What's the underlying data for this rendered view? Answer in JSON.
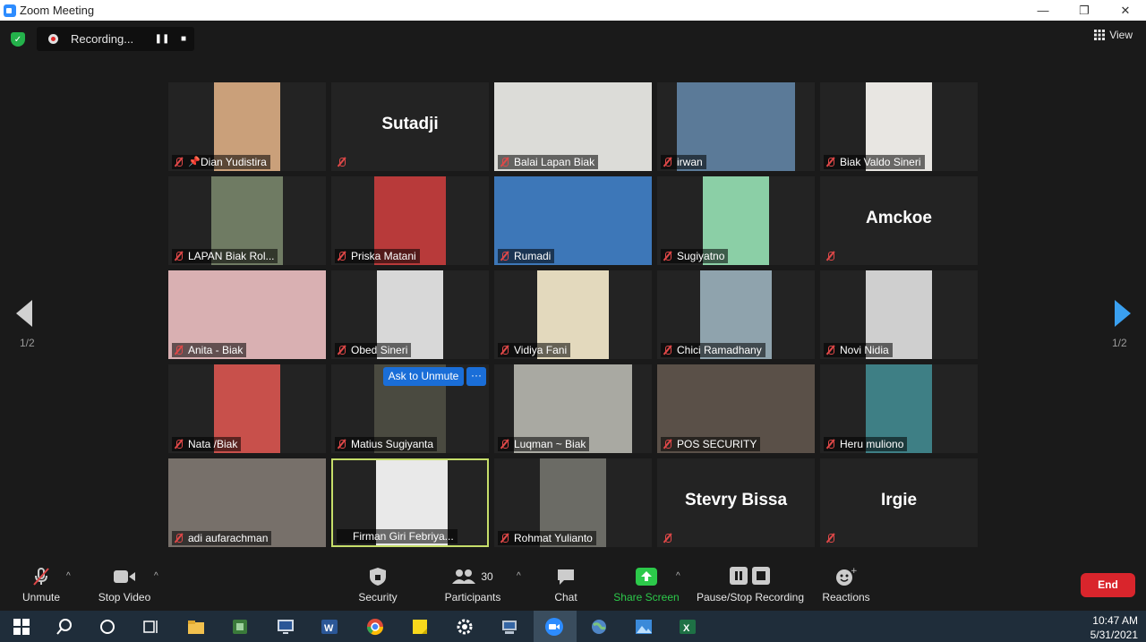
{
  "window": {
    "title": "Zoom Meeting",
    "minimize": "—",
    "maximize": "❐",
    "close": "✕"
  },
  "recording": {
    "status": "Recording...",
    "pause": "❚❚",
    "stop": "■"
  },
  "view_label": "View",
  "pagination": {
    "left": "1/2",
    "right": "1/2"
  },
  "ask_to_unmute": {
    "label": "Ask to Unmute",
    "more": "···"
  },
  "tiles": [
    {
      "name": "Dian Yudistira",
      "pinned": true,
      "video": true,
      "bg": "#caa07a",
      "vx": 51,
      "vw": 74
    },
    {
      "name": "Sutadji",
      "video": false,
      "label": false
    },
    {
      "name": "Balai Lapan Biak",
      "video": true,
      "bg": "#dcdcd8",
      "vx": 0,
      "vw": 176
    },
    {
      "name": "irwan",
      "video": true,
      "bg": "#5b7a98",
      "vx": 22,
      "vw": 132
    },
    {
      "name": "Biak Valdo Sineri",
      "video": true,
      "bg": "#e8e6e2",
      "vx": 51,
      "vw": 74
    },
    {
      "name": "LAPAN Biak Rol...",
      "video": true,
      "bg": "#6f7b63",
      "vx": 48,
      "vw": 80
    },
    {
      "name": "Priska Matani",
      "video": true,
      "bg": "#b83a3a",
      "vx": 48,
      "vw": 80
    },
    {
      "name": "Rumadi",
      "video": true,
      "bg": "#3d77b8",
      "vx": 0,
      "vw": 176
    },
    {
      "name": "Sugiyatno",
      "video": true,
      "bg": "#8bcfa6",
      "vx": 51,
      "vw": 74
    },
    {
      "name": "Amckoe",
      "video": false,
      "label": false
    },
    {
      "name": "Anita - Biak",
      "video": true,
      "bg": "#d9b0b2",
      "vx": 0,
      "vw": 176
    },
    {
      "name": "Obed Sineri",
      "video": true,
      "bg": "#d8d8d8",
      "vx": 51,
      "vw": 74
    },
    {
      "name": "Vidiya Fani",
      "video": true,
      "bg": "#e3d9bd",
      "vx": 48,
      "vw": 80
    },
    {
      "name": "Chici Ramadhany",
      "video": true,
      "bg": "#8fa3ad",
      "vx": 48,
      "vw": 80
    },
    {
      "name": "Novi Nidia",
      "video": true,
      "bg": "#cfcfcf",
      "vx": 51,
      "vw": 74
    },
    {
      "name": "Nata /Biak",
      "video": true,
      "bg": "#c8504b",
      "vx": 51,
      "vw": 74
    },
    {
      "name": "Matius Sugiyanta",
      "video": true,
      "bg": "#4a4a40",
      "vx": 48,
      "vw": 80
    },
    {
      "name": "Luqman ~ Biak",
      "video": true,
      "bg": "#a9a9a2",
      "vx": 22,
      "vw": 132
    },
    {
      "name": "POS SECURITY",
      "video": true,
      "bg": "#5a5048",
      "vx": 0,
      "vw": 176
    },
    {
      "name": "Heru muliono",
      "video": true,
      "bg": "#3e7f85",
      "vx": 51,
      "vw": 74
    },
    {
      "name": "adi aufarachman",
      "video": true,
      "bg": "#77706a",
      "vx": 0,
      "vw": 176
    },
    {
      "name": "Firman Giri Febriya...",
      "video": true,
      "bg": "#e9e9e9",
      "vx": 48,
      "vw": 80,
      "active": true,
      "muteIcon": false
    },
    {
      "name": "Rohmat Yulianto",
      "video": true,
      "bg": "#6b6b65",
      "vx": 51,
      "vw": 74
    },
    {
      "name": "Stevry Bissa",
      "video": false,
      "label": false
    },
    {
      "name": "Irgie",
      "video": false,
      "label": false
    }
  ],
  "toolbar": {
    "unmute": "Unmute",
    "stop_video": "Stop Video",
    "security": "Security",
    "participants": "Participants",
    "participants_count": "30",
    "chat": "Chat",
    "share_screen": "Share Screen",
    "pause_stop": "Pause/Stop Recording",
    "reactions": "Reactions",
    "end": "End"
  },
  "taskbar": {
    "time": "10:47 AM",
    "date": "5/31/2021"
  },
  "colors": {
    "accent_blue": "#2d8cff",
    "share_green": "#2cc94a",
    "end_red": "#d9252c",
    "active_border": "#c6de6a",
    "mute_red": "#e04848"
  }
}
